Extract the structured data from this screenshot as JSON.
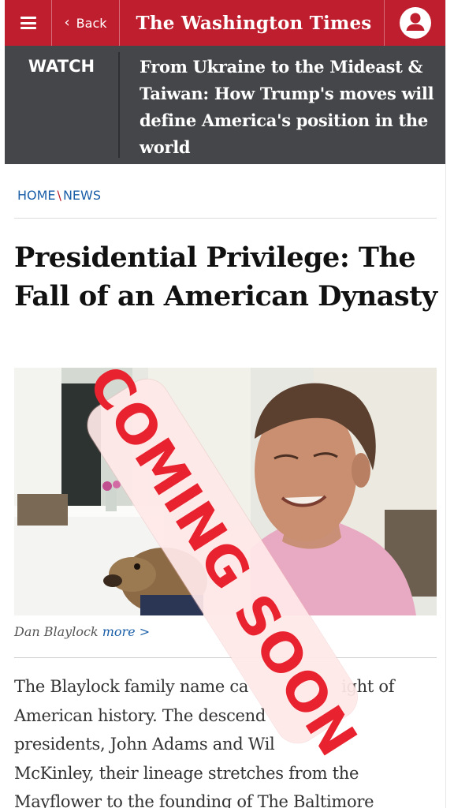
{
  "header": {
    "back_label": "Back",
    "logo_text": "The Washington Times",
    "brand_color": "#bf1e2e"
  },
  "watch_banner": {
    "tag": "WATCH",
    "headline": "From Ukraine to the Mideast & Taiwan: How Trump's moves will define America's position in the world"
  },
  "breadcrumb": {
    "home": "HOME",
    "separator": "\\",
    "section": "NEWS"
  },
  "article": {
    "title": "Presidential Privilege: The Fall of an American Dynasty",
    "byline_author": "Dan Blaylock",
    "byline_more": "more >",
    "body_lines": [
      "The Blaylock family name ca",
      "ight of",
      "American history. The descend",
      "presidents, John Adams and Wil",
      "McKinley, their lineage stretches from the",
      "Mayflower to the founding of The Baltimore"
    ]
  },
  "overlay": {
    "text": "COMING SOON"
  },
  "icons": {
    "menu": "hamburger-icon",
    "back": "chevron-left-icon",
    "account": "user-icon"
  }
}
